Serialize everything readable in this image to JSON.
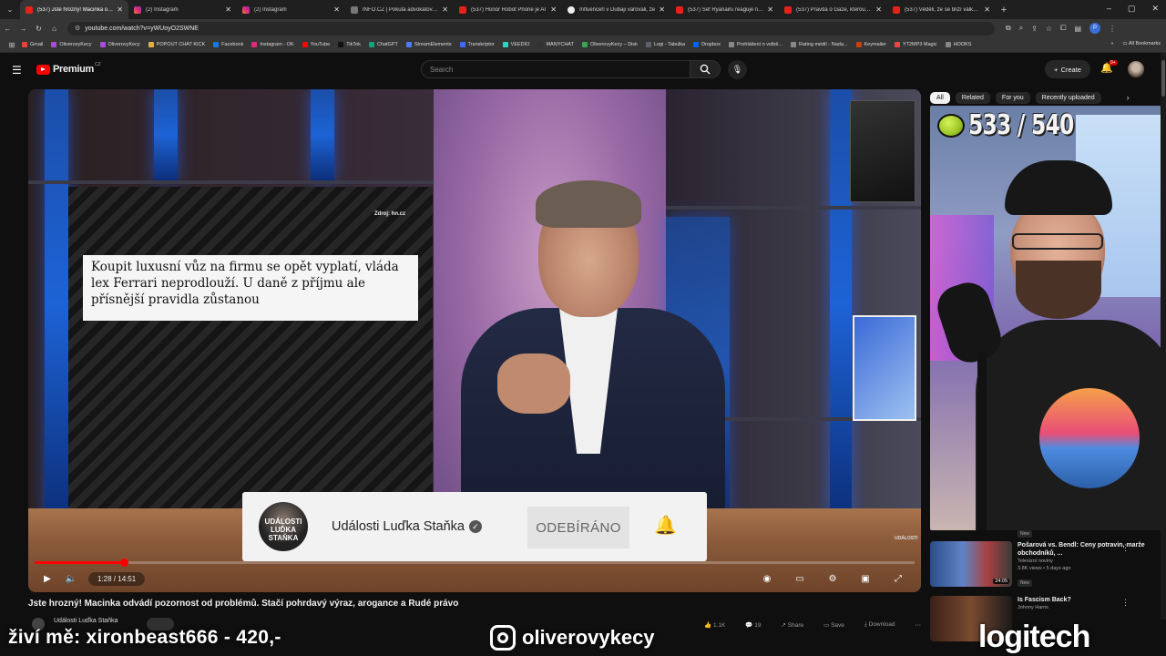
{
  "browser": {
    "tabs": [
      {
        "title": "(537) Jste hrozný! Macinka odvádí",
        "icon": "youtube",
        "active": true
      },
      {
        "title": "(2) Instagram",
        "icon": "instagram"
      },
      {
        "title": "(2) Instagram",
        "icon": "instagram"
      },
      {
        "title": "INFO.CZ | Pokuta advokátovi za",
        "icon": "generic"
      },
      {
        "title": "(537) Honor Robot Phone je AI",
        "icon": "youtube"
      },
      {
        "title": "Influenceři v Dubaji varovali, že",
        "icon": "white"
      },
      {
        "title": "(537) Šéf Ryanairu reaguje na B",
        "icon": "youtube"
      },
      {
        "title": "(537) Pravda o Gaze, kterou v t",
        "icon": "youtube"
      },
      {
        "title": "(537) Věděli, že se blíží válka, p",
        "icon": "youtube"
      }
    ],
    "url": "youtube.com/watch?v=yWUoyO2SWNE",
    "bookmarks": [
      "Gmail",
      "OliverovyKecy",
      "OliverovyKecy",
      "POPOUT CHAT KICK",
      "Facebook",
      "Instagram - OK",
      "YouTube",
      "TikTok",
      "ChatGPT",
      "StreamElements",
      "Transkriptor",
      "VEEDIO",
      "MANYCHAT",
      "OliverovyKecy – Disk",
      "Logi - Tabulka",
      "Dropbox",
      "Prohlášení o volbě...",
      "Rating médií - Nada...",
      "Keymailer",
      "YT2MP3 Magic",
      "HOOKS"
    ],
    "all_bookmarks": "All Bookmarks",
    "profile_initial": "P"
  },
  "youtube": {
    "logo_word": "Premium",
    "logo_region": "CZ",
    "search_placeholder": "Search",
    "create_label": "Create",
    "notif_badge": "9+"
  },
  "video": {
    "screen_source": "Zdroj: hn.cz",
    "headline": "Koupit luxusní vůz na firmu se opět vyplatí, vláda lex Ferrari neprodlouží. U daně z příjmu ale přísnější pravidla zůstanou",
    "card_channel": "Události Luďka Staňka",
    "card_avatar_text": "UDÁLOSTI LUĎKA STAŇKA",
    "card_button": "ODEBÍRÁNO",
    "watermark": "UDÁLOSTI",
    "time": "1:28 / 14:51",
    "progress": 0.101,
    "title": "Jste hrozný! Macinka odvádí pozornost od problémů. Stačí pohrdavý výraz, arogance a Rudé právo",
    "channel": "Události Luďka Staňka",
    "likes": "1.1K",
    "comments": "19",
    "share": "Share",
    "save": "Save",
    "download": "Download"
  },
  "sidebar": {
    "chips": [
      "All",
      "Related",
      "For you",
      "Recently uploaded"
    ],
    "active_chip": 0,
    "counter": "533 / 540",
    "prev_new": "New",
    "recommendations": [
      {
        "title": "Pošarová vs. Bendl: Ceny potravin, marže obchodníků, ...",
        "channel": "Televizní noviny",
        "meta": "3.8K views • 5 days ago",
        "badge": "New",
        "duration": "24:05"
      },
      {
        "title": "Is Fascism Back?",
        "channel": "Johnny Harris",
        "meta": "",
        "badge": "",
        "duration": ""
      }
    ]
  },
  "overlay": {
    "support": "živí mě: xironbeast666 - 420,-",
    "instagram": "oliverovykecy",
    "sponsor": "logitech"
  }
}
